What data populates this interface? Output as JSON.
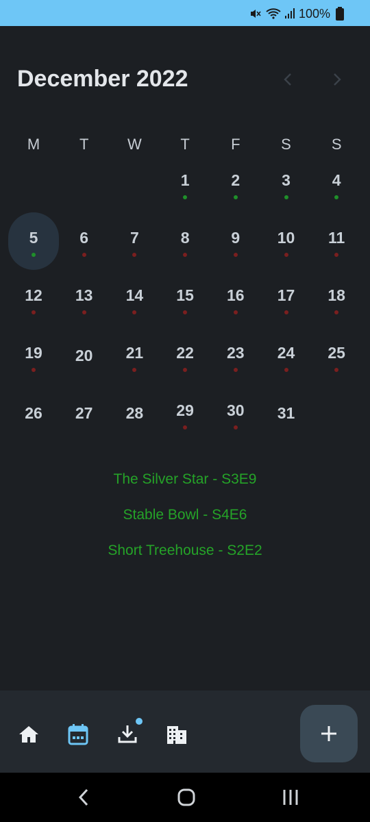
{
  "status_bar": {
    "battery_text": "100%",
    "icons": [
      "mute-icon",
      "wifi-icon",
      "signal-icon",
      "battery-icon"
    ]
  },
  "calendar": {
    "month_title": "December 2022",
    "weekdays": [
      "M",
      "T",
      "W",
      "T",
      "F",
      "S",
      "S"
    ],
    "selected_day": "5",
    "days": [
      {
        "n": "1",
        "dot": "green"
      },
      {
        "n": "2",
        "dot": "green"
      },
      {
        "n": "3",
        "dot": "green"
      },
      {
        "n": "4",
        "dot": "green"
      },
      {
        "n": "5",
        "dot": "green"
      },
      {
        "n": "6",
        "dot": "red"
      },
      {
        "n": "7",
        "dot": "red"
      },
      {
        "n": "8",
        "dot": "red"
      },
      {
        "n": "9",
        "dot": "red"
      },
      {
        "n": "10",
        "dot": "red"
      },
      {
        "n": "11",
        "dot": "red"
      },
      {
        "n": "12",
        "dot": "red"
      },
      {
        "n": "13",
        "dot": "red"
      },
      {
        "n": "14",
        "dot": "red"
      },
      {
        "n": "15",
        "dot": "red"
      },
      {
        "n": "16",
        "dot": "red"
      },
      {
        "n": "17",
        "dot": "red"
      },
      {
        "n": "18",
        "dot": "red"
      },
      {
        "n": "19",
        "dot": "red"
      },
      {
        "n": "20",
        "dot": ""
      },
      {
        "n": "21",
        "dot": "red"
      },
      {
        "n": "22",
        "dot": "red"
      },
      {
        "n": "23",
        "dot": "red"
      },
      {
        "n": "24",
        "dot": "red"
      },
      {
        "n": "25",
        "dot": "red"
      },
      {
        "n": "26",
        "dot": ""
      },
      {
        "n": "27",
        "dot": ""
      },
      {
        "n": "28",
        "dot": ""
      },
      {
        "n": "29",
        "dot": "red"
      },
      {
        "n": "30",
        "dot": "red"
      },
      {
        "n": "31",
        "dot": ""
      }
    ],
    "first_weekday_index": 3
  },
  "events": [
    "The Silver Star - S3E9",
    "Stable Bowl - S4E6",
    "Short Treehouse - S2E2"
  ],
  "bottom_nav": {
    "items": [
      "home-icon",
      "calendar-icon",
      "download-icon",
      "building-icon"
    ],
    "active": "calendar-icon",
    "fab_icon": "plus-icon"
  },
  "colors": {
    "accent": "#6ec6f6",
    "event_dot_green": "#1f8f2a",
    "event_dot_red": "#7a1f1f",
    "event_text": "#25a328"
  }
}
